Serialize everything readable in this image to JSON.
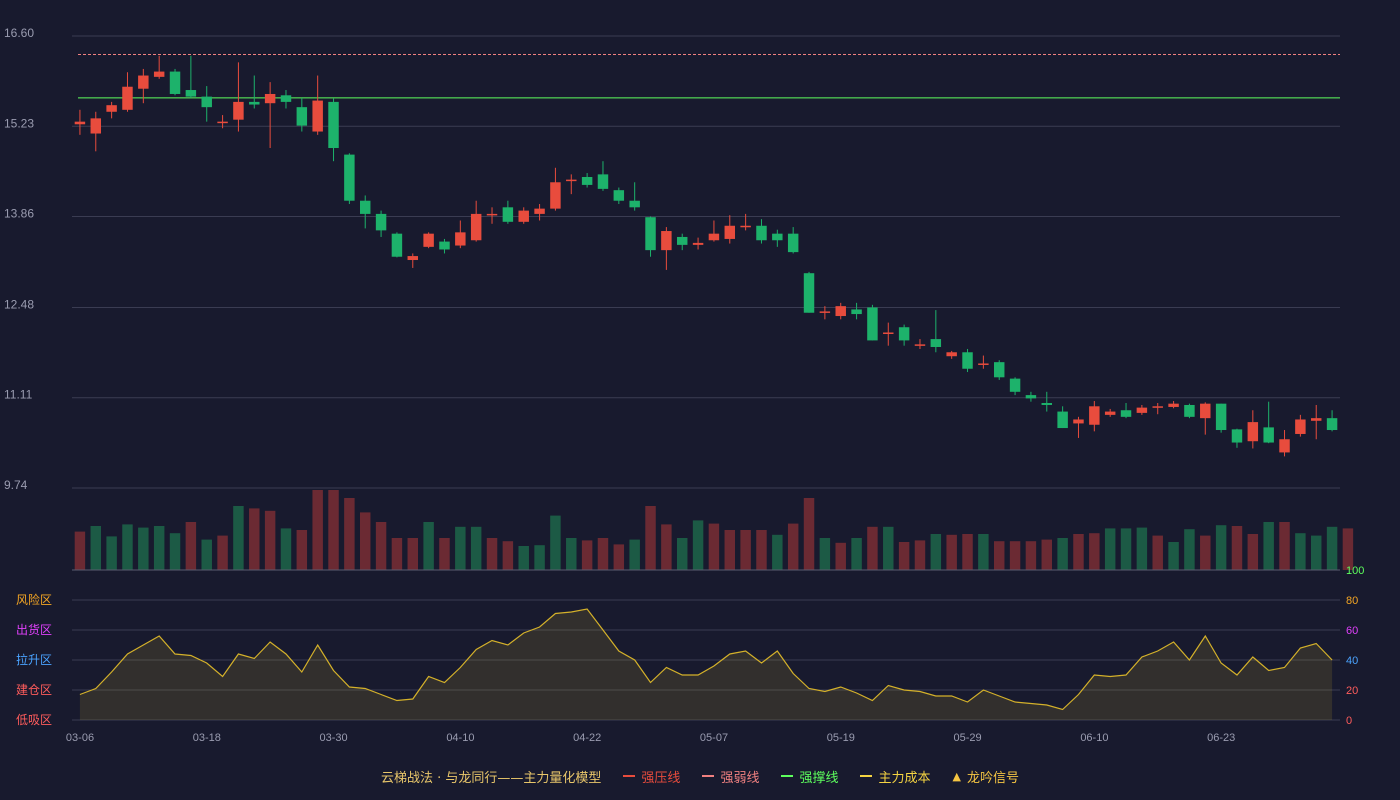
{
  "legend": {
    "title": "云梯战法 · 与龙同行——主力量化模型",
    "items": [
      {
        "label": "强压线",
        "color": "#e84c3d",
        "style": "solid"
      },
      {
        "label": "强弱线",
        "color": "#f08080",
        "style": "dashed"
      },
      {
        "label": "强撑线",
        "color": "#5dff5d",
        "style": "solid"
      },
      {
        "label": "主力成本",
        "color": "#f5d442",
        "style": "dashed"
      },
      {
        "label": "龙吟信号",
        "color": "#f5c542",
        "style": "triangle"
      }
    ]
  },
  "colors": {
    "background": "#181a2e",
    "up": "#e84c3d",
    "down": "#1db26b",
    "grid": "#3a3c52",
    "oscillator": "#d4b12a"
  },
  "chart_data": [
    {
      "type": "candlestick",
      "y_ticks": [
        "16.60",
        "15.23",
        "13.86",
        "12.48",
        "11.11",
        "9.74"
      ],
      "ylim": [
        9.74,
        16.6
      ],
      "x_ticks": [
        {
          "i": 0,
          "label": "03-06"
        },
        {
          "i": 8,
          "label": "03-18"
        },
        {
          "i": 16,
          "label": "03-30"
        },
        {
          "i": 24,
          "label": "04-10"
        },
        {
          "i": 32,
          "label": "04-22"
        },
        {
          "i": 40,
          "label": "05-07"
        },
        {
          "i": 48,
          "label": "05-19"
        },
        {
          "i": 56,
          "label": "05-29"
        },
        {
          "i": 64,
          "label": "06-10"
        },
        {
          "i": 72,
          "label": "06-23"
        }
      ],
      "reference_lines": [
        {
          "name": "强弱线",
          "value": 16.32,
          "style": "dashed",
          "color": "#f08080"
        },
        {
          "name": "强撑线",
          "value": 15.66,
          "style": "solid",
          "color": "#5dff5d"
        }
      ],
      "candles": [
        [
          15.26,
          15.3,
          15.48,
          15.1
        ],
        [
          15.12,
          15.35,
          15.45,
          14.85
        ],
        [
          15.45,
          15.55,
          15.6,
          15.35
        ],
        [
          15.48,
          15.83,
          16.05,
          15.45
        ],
        [
          15.8,
          16.0,
          16.1,
          15.58
        ],
        [
          15.98,
          16.06,
          16.3,
          15.95
        ],
        [
          16.06,
          15.72,
          16.1,
          15.7
        ],
        [
          15.78,
          15.68,
          16.3,
          15.66
        ],
        [
          15.68,
          15.52,
          15.84,
          15.3
        ],
        [
          15.3,
          15.3,
          15.4,
          15.2
        ],
        [
          15.33,
          15.6,
          16.2,
          15.15
        ],
        [
          15.6,
          15.56,
          16.0,
          15.5
        ],
        [
          15.58,
          15.72,
          15.9,
          14.9
        ],
        [
          15.7,
          15.6,
          15.78,
          15.5
        ],
        [
          15.52,
          15.24,
          15.66,
          15.15
        ],
        [
          15.15,
          15.62,
          16.0,
          15.1
        ],
        [
          15.6,
          14.9,
          15.65,
          14.7
        ],
        [
          14.8,
          14.1,
          14.82,
          14.05
        ],
        [
          14.1,
          13.9,
          14.18,
          13.68
        ],
        [
          13.9,
          13.65,
          13.95,
          13.55
        ],
        [
          13.6,
          13.25,
          13.62,
          13.24
        ],
        [
          13.2,
          13.26,
          13.3,
          13.08
        ],
        [
          13.4,
          13.6,
          13.62,
          13.38
        ],
        [
          13.48,
          13.36,
          13.52,
          13.3
        ],
        [
          13.42,
          13.62,
          13.8,
          13.38
        ],
        [
          13.5,
          13.9,
          14.1,
          13.48
        ],
        [
          13.9,
          13.9,
          14.0,
          13.75
        ],
        [
          14.0,
          13.78,
          14.1,
          13.75
        ],
        [
          13.78,
          13.95,
          14.0,
          13.75
        ],
        [
          13.9,
          13.98,
          14.05,
          13.8
        ],
        [
          13.98,
          14.38,
          14.6,
          13.95
        ],
        [
          14.4,
          14.42,
          14.5,
          14.2
        ],
        [
          14.46,
          14.34,
          14.52,
          14.3
        ],
        [
          14.5,
          14.28,
          14.7,
          14.25
        ],
        [
          14.26,
          14.1,
          14.3,
          14.05
        ],
        [
          14.1,
          14.0,
          14.38,
          13.95
        ],
        [
          13.85,
          13.35,
          13.86,
          13.25
        ],
        [
          13.35,
          13.64,
          13.7,
          13.05
        ],
        [
          13.55,
          13.43,
          13.6,
          13.35
        ],
        [
          13.43,
          13.46,
          13.54,
          13.36
        ],
        [
          13.5,
          13.6,
          13.8,
          13.48
        ],
        [
          13.52,
          13.72,
          13.88,
          13.45
        ],
        [
          13.7,
          13.72,
          13.9,
          13.65
        ],
        [
          13.72,
          13.5,
          13.82,
          13.45
        ],
        [
          13.6,
          13.5,
          13.66,
          13.4
        ],
        [
          13.6,
          13.32,
          13.7,
          13.3
        ],
        [
          13.0,
          12.4,
          13.02,
          12.4
        ],
        [
          12.4,
          12.42,
          12.5,
          12.3
        ],
        [
          12.35,
          12.5,
          12.55,
          12.3
        ],
        [
          12.45,
          12.38,
          12.55,
          12.3
        ],
        [
          12.48,
          11.98,
          12.52,
          11.98
        ],
        [
          12.08,
          12.1,
          12.25,
          11.9
        ],
        [
          12.18,
          11.98,
          12.22,
          11.9
        ],
        [
          11.9,
          11.92,
          12.0,
          11.85
        ],
        [
          12.0,
          11.88,
          12.44,
          11.8
        ],
        [
          11.74,
          11.8,
          11.82,
          11.7
        ],
        [
          11.8,
          11.55,
          11.85,
          11.5
        ],
        [
          11.63,
          11.63,
          11.75,
          11.55
        ],
        [
          11.65,
          11.42,
          11.68,
          11.38
        ],
        [
          11.4,
          11.2,
          11.42,
          11.15
        ],
        [
          11.15,
          11.1,
          11.2,
          11.05
        ],
        [
          11.03,
          11.0,
          11.2,
          10.9
        ],
        [
          10.9,
          10.65,
          10.98,
          10.65
        ],
        [
          10.72,
          10.78,
          10.82,
          10.5
        ],
        [
          10.7,
          10.98,
          11.06,
          10.6
        ],
        [
          10.85,
          10.9,
          10.94,
          10.82
        ],
        [
          10.92,
          10.82,
          11.03,
          10.8
        ],
        [
          10.88,
          10.96,
          11.0,
          10.85
        ],
        [
          10.98,
          10.98,
          11.03,
          10.86
        ],
        [
          10.97,
          11.02,
          11.06,
          10.95
        ],
        [
          11.0,
          10.82,
          11.02,
          10.8
        ],
        [
          10.8,
          11.02,
          11.04,
          10.55
        ],
        [
          11.02,
          10.62,
          11.02,
          10.58
        ],
        [
          10.63,
          10.43,
          10.64,
          10.35
        ],
        [
          10.45,
          10.74,
          10.92,
          10.34
        ],
        [
          10.66,
          10.43,
          11.05,
          10.42
        ],
        [
          10.28,
          10.48,
          10.62,
          10.22
        ],
        [
          10.56,
          10.78,
          10.85,
          10.52
        ],
        [
          10.76,
          10.8,
          11.0,
          10.48
        ],
        [
          10.8,
          10.62,
          10.92,
          10.6
        ]
      ]
    },
    {
      "type": "bar",
      "name": "volume",
      "values": [
        48,
        55,
        42,
        57,
        53,
        55,
        46,
        60,
        38,
        43,
        80,
        77,
        74,
        52,
        50,
        100,
        100,
        90,
        72,
        60,
        40,
        40,
        60,
        40,
        54,
        54,
        40,
        36,
        30,
        31,
        68,
        40,
        37,
        40,
        32,
        38,
        80,
        57,
        40,
        62,
        58,
        50,
        50,
        50,
        44,
        58,
        90,
        40,
        34,
        40,
        54,
        54,
        35,
        37,
        45,
        44,
        45,
        45,
        36,
        36,
        36,
        38,
        40,
        45,
        46,
        52,
        52,
        53,
        43,
        35,
        51,
        43,
        56,
        55,
        45,
        60,
        60,
        46,
        43,
        54,
        52
      ],
      "up": [
        1,
        0,
        0,
        0,
        0,
        0,
        0,
        1,
        0,
        1,
        0,
        1,
        1,
        0,
        1,
        1,
        1,
        1,
        1,
        1,
        1,
        1,
        0,
        1,
        0,
        0,
        1,
        1,
        0,
        0,
        0,
        0,
        1,
        1,
        1,
        0,
        1,
        1,
        0,
        0,
        1,
        1,
        1,
        1,
        0,
        1,
        1,
        0,
        1,
        0,
        1,
        0,
        1,
        1,
        0,
        1,
        1,
        0,
        1,
        1,
        1,
        1,
        0,
        1,
        1,
        0,
        0,
        0,
        1,
        0,
        0,
        1,
        0,
        1,
        1,
        0,
        1,
        0,
        0,
        0,
        1
      ]
    },
    {
      "type": "area",
      "name": "oscillator",
      "y_ticks": [
        "0",
        "20",
        "40",
        "60",
        "80",
        "100"
      ],
      "ylim": [
        0,
        100
      ],
      "zone_labels": [
        {
          "label": "风险区",
          "value": 80,
          "color": "#f5a623"
        },
        {
          "label": "出货区",
          "value": 60,
          "color": "#e040fb"
        },
        {
          "label": "拉升区",
          "value": 40,
          "color": "#4aa3ff"
        },
        {
          "label": "建仓区",
          "value": 20,
          "color": "#ff5c5c"
        },
        {
          "label": "低吸区",
          "value": 0,
          "color": "#ff5c5c"
        }
      ],
      "values": [
        17,
        21,
        32,
        44,
        50,
        56,
        44,
        43,
        38,
        29,
        44,
        41,
        52,
        44,
        32,
        50,
        33,
        22,
        21,
        17,
        13,
        14,
        29,
        25,
        35,
        47,
        53,
        50,
        58,
        62,
        71,
        72,
        74,
        60,
        46,
        40,
        25,
        35,
        30,
        30,
        36,
        44,
        46,
        38,
        46,
        31,
        21,
        19,
        22,
        18,
        13,
        23,
        20,
        19,
        16,
        16,
        12,
        20,
        16,
        12,
        11,
        10,
        7,
        17,
        30,
        29,
        30,
        42,
        46,
        52,
        40,
        56,
        38,
        30,
        42,
        33,
        35,
        48,
        51,
        40
      ]
    }
  ]
}
